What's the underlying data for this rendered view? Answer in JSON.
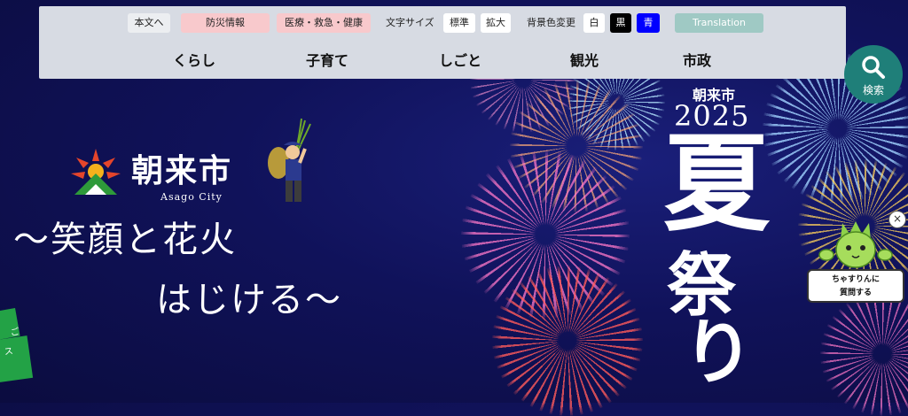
{
  "toolbar": {
    "skip_to_content": "本文へ",
    "disaster_info": "防災情報",
    "medical": "医療・救急・健康",
    "font_size_label": "文字サイズ",
    "font_standard": "標準",
    "font_large": "拡大",
    "bg_color_label": "背景色変更",
    "bg_white": "白",
    "bg_black": "黒",
    "bg_blue": "青",
    "translation": "Translation"
  },
  "nav": {
    "items": [
      {
        "label": "くらし"
      },
      {
        "label": "子育て"
      },
      {
        "label": "しごと"
      },
      {
        "label": "観光"
      },
      {
        "label": "市政"
      }
    ]
  },
  "search": {
    "label": "検索",
    "icon": "search-icon"
  },
  "brand": {
    "city_name": "朝来市",
    "city_en": "Asago City",
    "slogan_line1": "～笑顔と花火",
    "slogan_line2": "はじける～"
  },
  "festival": {
    "city": "朝来市",
    "year": "2025",
    "title_part1": "夏",
    "title_part2": "祭",
    "title_part3": "り"
  },
  "side_tabs": {
    "tab1": "ご",
    "tab2": "ス"
  },
  "chat": {
    "line1": "ちゃすりんに",
    "line2": "質問する",
    "close": "×"
  },
  "colors": {
    "background": "#10125a",
    "header_bg": "#d7dbe3",
    "alert_pink": "#f8c9cc",
    "search_teal": "#1f7f79",
    "translation_teal": "#9fc9c4",
    "bg_black_btn": "#000000",
    "bg_blue_btn": "#0000ff"
  }
}
